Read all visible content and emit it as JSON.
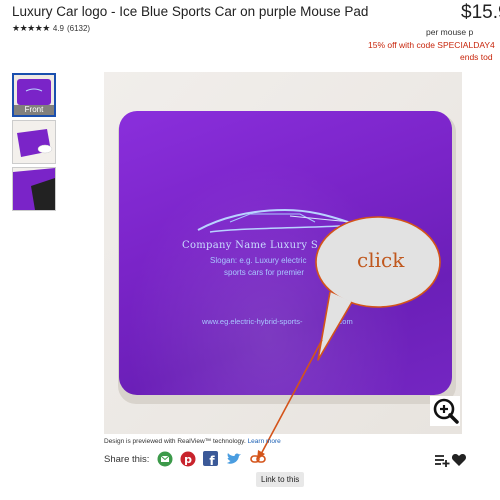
{
  "product": {
    "title": "Luxury Car logo - Ice Blue Sports Car on purple Mouse Pad",
    "stars": "★★★★★",
    "rating": "4.9",
    "review_count": "(6132)"
  },
  "pricing": {
    "price": "$15.9",
    "per_unit": "per mouse p",
    "promo": "15% off with code SPECIALDAY4",
    "promo_end": "ends tod"
  },
  "thumbnails": [
    {
      "label": "Front",
      "active": true
    },
    {
      "label": "",
      "active": false
    },
    {
      "label": "",
      "active": false
    }
  ],
  "mousepad": {
    "company_name": "Company Name Luxury S",
    "slogan_line1": "Slogan: e.g. Luxury electric",
    "slogan_line2": "sports cars for premier",
    "url": "www.eg.electric-hybrid-sports-",
    "url_tail": ".com"
  },
  "annotation": {
    "callout_text": "click"
  },
  "footer": {
    "preview_note": "Design is previewed with RealView™ technology.",
    "learn_more": "Learn more",
    "share_label": "Share this:",
    "tooltip": "Link to this"
  },
  "icons": [
    "email-icon",
    "pinterest-icon",
    "facebook-icon",
    "twitter-icon",
    "link-icon",
    "add-to-list-icon",
    "heart-icon",
    "zoom-in-icon"
  ],
  "colors": {
    "pad_purple": "#7a24c8",
    "promo_red": "#c8260c",
    "callout_orange": "#d4541a",
    "link_blue": "#1a5fb4"
  }
}
